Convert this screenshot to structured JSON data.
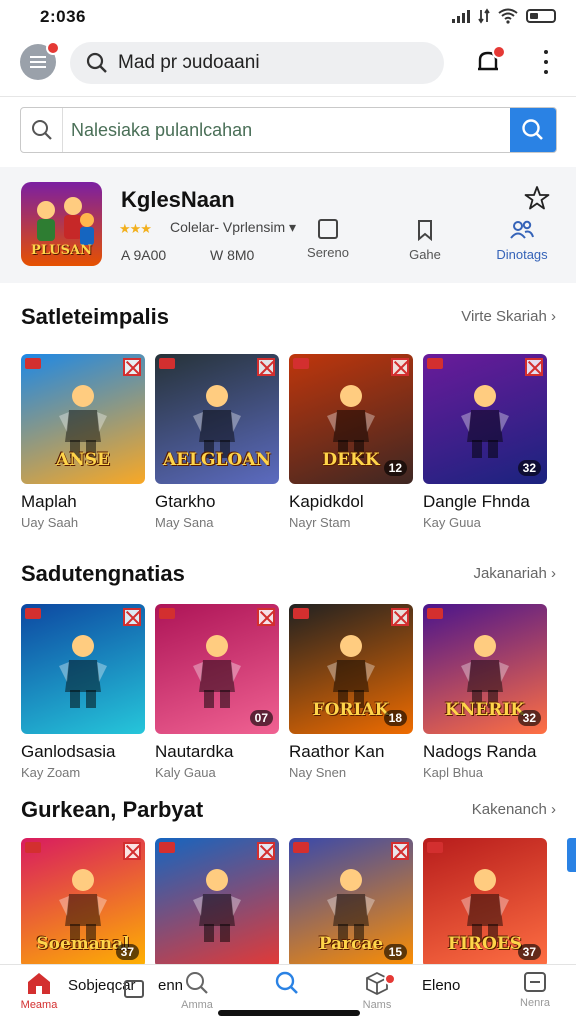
{
  "status_bar": {
    "time": "2:036"
  },
  "top_bar": {
    "search_text": "Mad pr ɔudoaani"
  },
  "search": {
    "placeholder": "Nalesiaka pulanlcahan"
  },
  "featured": {
    "title": "KglesNaan",
    "thumb_text": "PLUSAN",
    "genre": "Colelar- Vprlensim ▾",
    "stat_left": "A 9A00",
    "stat_right": "W 8M0",
    "actions": [
      "Sereno",
      "Gahe",
      "Dinotags"
    ]
  },
  "sections": [
    {
      "title": "Satleteimpalis",
      "see_all": "Virte Skariah",
      "items": [
        {
          "name": "Maplah",
          "sub": "Uay Saah",
          "art_text": "ANSE",
          "num": "",
          "colors": [
            "#1e88e5",
            "#f9a825"
          ]
        },
        {
          "name": "Gtarkho",
          "sub": "May Sana",
          "art_text": "AELGLOAN",
          "num": "",
          "colors": [
            "#263238",
            "#5c6bc0"
          ]
        },
        {
          "name": "Kapidkdol",
          "sub": "Nayr Stam",
          "art_text": "DEKK",
          "num": "12",
          "colors": [
            "#bf360c",
            "#3e2723"
          ]
        },
        {
          "name": "Dangle Fhnda",
          "sub": "Kay Guua",
          "art_text": "",
          "num": "32",
          "colors": [
            "#6a1b9a",
            "#1a237e"
          ]
        }
      ]
    },
    {
      "title": "Sadutengnatias",
      "see_all": "Jakanariah",
      "items": [
        {
          "name": "Ganlodsasia",
          "sub": "Kay Zoam",
          "art_text": "",
          "num": "",
          "colors": [
            "#0d47a1",
            "#26c6da"
          ]
        },
        {
          "name": "Nautardka",
          "sub": "Kaly Gaua",
          "art_text": "",
          "num": "07",
          "colors": [
            "#ad1457",
            "#f06292"
          ]
        },
        {
          "name": "Raathor Kan",
          "sub": "Nay Snen",
          "art_text": "FORIAK",
          "num": "18",
          "colors": [
            "#212121",
            "#ef6c00"
          ]
        },
        {
          "name": "Nadogs Randa",
          "sub": "Kapl Bhua",
          "art_text": "KNERIK",
          "num": "32",
          "colors": [
            "#4a148c",
            "#ff7043"
          ]
        }
      ]
    },
    {
      "title": "Gurkean, Parbyat",
      "see_all": "Kakenanch",
      "items": [
        {
          "name": "",
          "sub": "",
          "art_text": "Soemanal",
          "num": "37",
          "colors": [
            "#d81b60",
            "#ffb300"
          ]
        },
        {
          "name": "",
          "sub": "",
          "art_text": "",
          "num": "",
          "colors": [
            "#1565c0",
            "#e53935"
          ]
        },
        {
          "name": "",
          "sub": "",
          "art_text": "Parcae",
          "num": "15",
          "colors": [
            "#3949ab",
            "#ff8f00"
          ]
        },
        {
          "name": "",
          "sub": "",
          "art_text": "FIROES",
          "num": "37",
          "colors": [
            "#b71c1c",
            "#ff7043"
          ]
        }
      ]
    }
  ],
  "bottom_nav": {
    "items": [
      "Meama",
      "Amma",
      "",
      "Nams",
      "Nenra"
    ],
    "floating_left": "Sobjeqcar",
    "floating_mid": "enn",
    "floating_right": "Eleno"
  }
}
